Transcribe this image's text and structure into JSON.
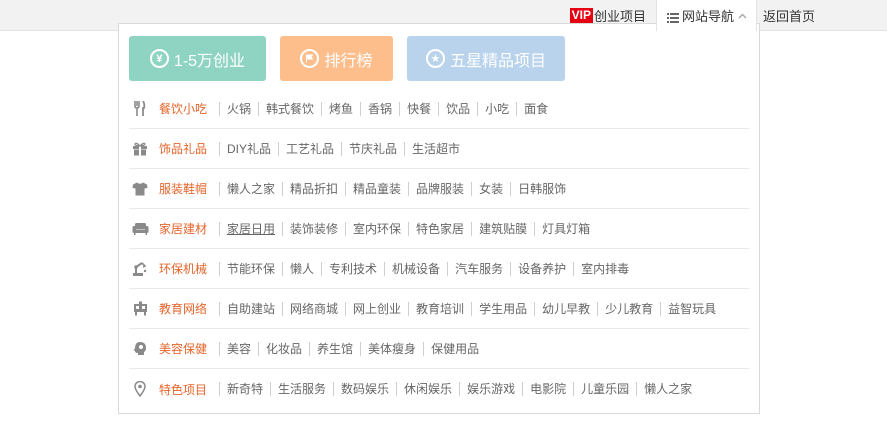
{
  "topnav": {
    "vip_badge": "VIP",
    "vip_label": "创业项目",
    "nav_label": "网站导航",
    "home_label": "返回首页"
  },
  "buttons": [
    {
      "label": "1-5万创业",
      "icon": "yen-icon",
      "color": "#8fd4c3"
    },
    {
      "label": "排行榜",
      "icon": "flag-icon",
      "color": "#fdbe8c"
    },
    {
      "label": "五星精品项目",
      "icon": "star-icon",
      "color": "#b9d3ec"
    }
  ],
  "categories": [
    {
      "name": "餐饮小吃",
      "icon": "fork-knife-icon",
      "links": [
        "火锅",
        "韩式餐饮",
        "烤鱼",
        "香锅",
        "快餐",
        "饮品",
        "小吃",
        "面食"
      ]
    },
    {
      "name": "饰品礼品",
      "icon": "gift-icon",
      "links": [
        "DIY礼品",
        "工艺礼品",
        "节庆礼品",
        "生活超市"
      ]
    },
    {
      "name": "服装鞋帽",
      "icon": "shirt-icon",
      "links": [
        "懒人之家",
        "精品折扣",
        "精品童装",
        "品牌服装",
        "女装",
        "日韩服饰"
      ]
    },
    {
      "name": "家居建材",
      "icon": "sofa-icon",
      "links": [
        "家居日用",
        "装饰装修",
        "室内环保",
        "特色家居",
        "建筑贴膜",
        "灯具灯箱"
      ]
    },
    {
      "name": "环保机械",
      "icon": "machine-icon",
      "links": [
        "节能环保",
        "懒人",
        "专利技术",
        "机械设备",
        "汽车服务",
        "设备养护",
        "室内排毒"
      ]
    },
    {
      "name": "教育网络",
      "icon": "education-icon",
      "links": [
        "自助建站",
        "网络商城",
        "网上创业",
        "教育培训",
        "学生用品",
        "幼儿早教",
        "少儿教育",
        "益智玩具"
      ]
    },
    {
      "name": "美容保健",
      "icon": "beauty-icon",
      "links": [
        "美容",
        "化妆品",
        "养生馆",
        "美体瘦身",
        "保健用品"
      ]
    },
    {
      "name": "特色项目",
      "icon": "location-pin-icon",
      "links": [
        "新奇特",
        "生活服务",
        "数码娱乐",
        "休闲娱乐",
        "娱乐游戏",
        "电影院",
        "儿童乐园",
        "懒人之家"
      ]
    }
  ],
  "colors": {
    "category": "#e6642a",
    "vip": "#e60012"
  }
}
